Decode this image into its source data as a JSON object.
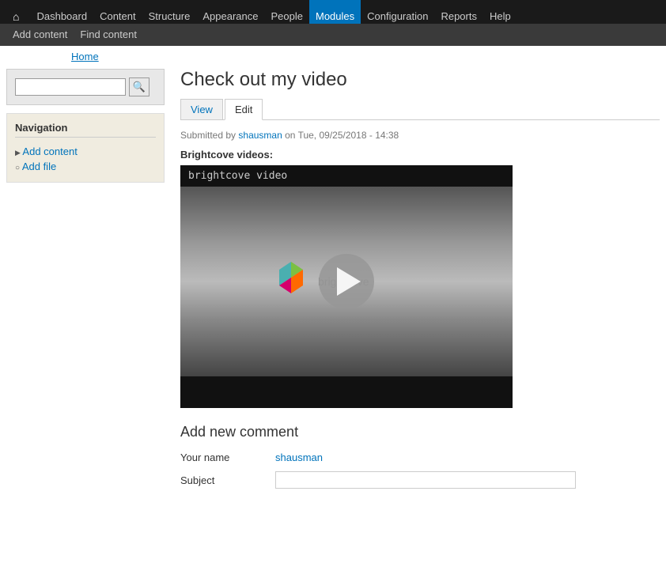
{
  "topnav": {
    "home_icon": "⌂",
    "items": [
      {
        "label": "Dashboard",
        "active": false
      },
      {
        "label": "Content",
        "active": false
      },
      {
        "label": "Structure",
        "active": false
      },
      {
        "label": "Appearance",
        "active": false
      },
      {
        "label": "People",
        "active": false
      },
      {
        "label": "Modules",
        "active": true
      },
      {
        "label": "Configuration",
        "active": false
      },
      {
        "label": "Reports",
        "active": false
      },
      {
        "label": "Help",
        "active": false
      }
    ]
  },
  "secondary_nav": {
    "items": [
      {
        "label": "Add content"
      },
      {
        "label": "Find content"
      }
    ]
  },
  "breadcrumb": {
    "home_label": "Home"
  },
  "sidebar": {
    "search_placeholder": "",
    "search_button_icon": "🔍",
    "navigation_title": "Navigation",
    "nav_items": [
      {
        "label": "Add content",
        "type": "arrow"
      },
      {
        "label": "Add file",
        "type": "circle"
      }
    ]
  },
  "content": {
    "page_title": "Check out my video",
    "tabs": [
      {
        "label": "View",
        "active": false
      },
      {
        "label": "Edit",
        "active": true
      }
    ],
    "submitted_text": "Submitted by",
    "author": "shausman",
    "submitted_date": "on Tue, 09/25/2018 - 14:38",
    "video_section_label": "Brightcove videos:",
    "video_header_text": "brightcove video",
    "comment": {
      "title": "Add new comment",
      "your_name_label": "Your name",
      "your_name_value": "shausman",
      "subject_label": "Subject"
    }
  }
}
